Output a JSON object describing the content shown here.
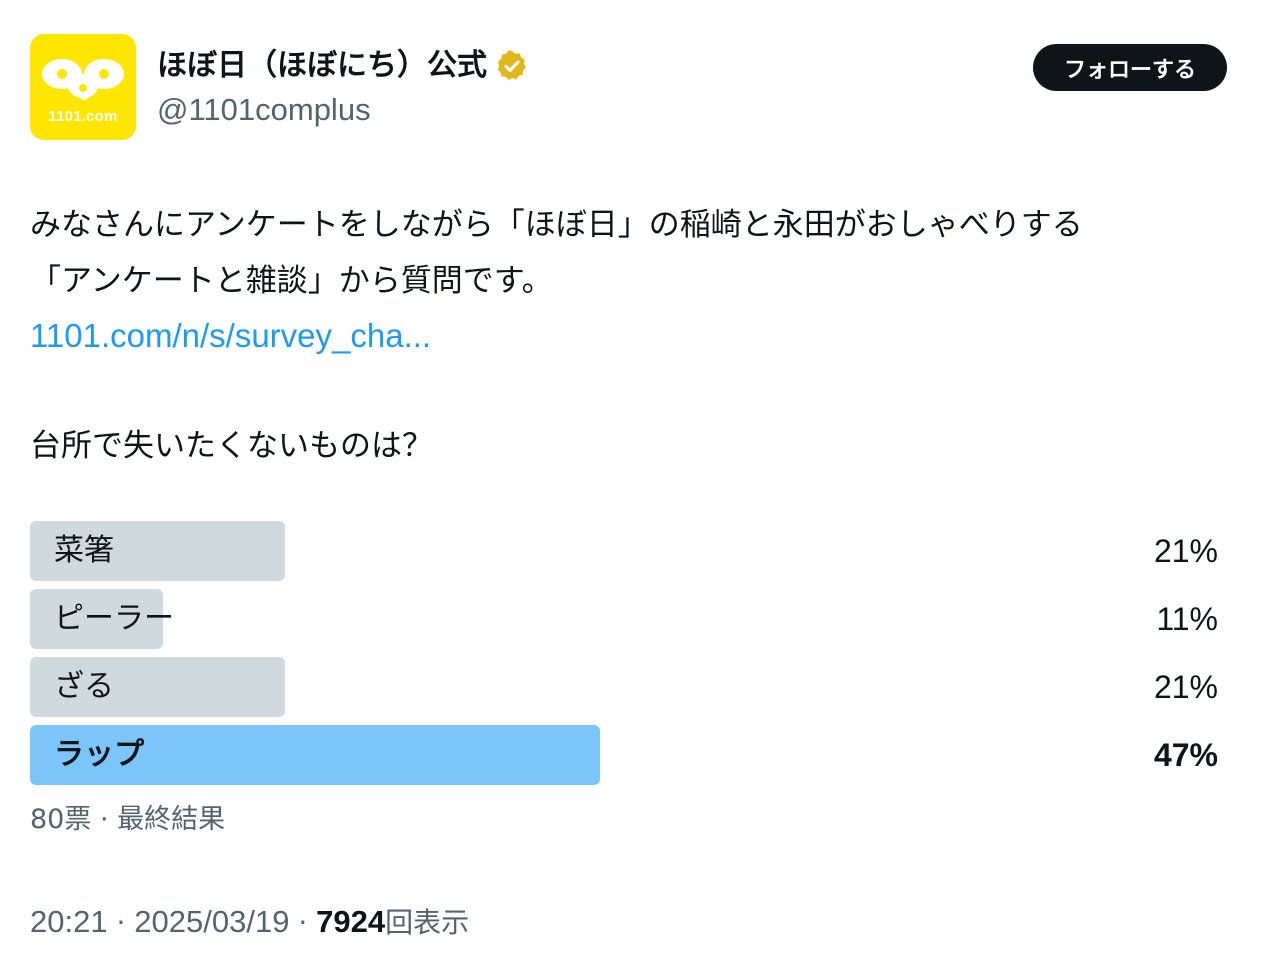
{
  "account": {
    "display_name": "ほぼ日（ほぼにち）公式",
    "handle": "@1101complus",
    "avatar_text": "1101.com",
    "avatar_color": "#ffe600",
    "verified_color": "#e2b719"
  },
  "follow_button": {
    "label": "フォローする"
  },
  "tweet": {
    "line1": "みなさんにアンケートをしながら「ほぼ日」の稲崎と永田がおしゃべりする",
    "line2": "「アンケートと雑談」から質問です。",
    "link": "1101.com/n/s/survey_cha...",
    "question": "台所で失いたくないものは？"
  },
  "poll": {
    "options": [
      {
        "label": "菜箸",
        "percent_text": "21%",
        "percent": 21,
        "winner": false
      },
      {
        "label": "ピーラー",
        "percent_text": "11%",
        "percent": 11,
        "winner": false
      },
      {
        "label": "ざる",
        "percent_text": "21%",
        "percent": 21,
        "winner": false
      },
      {
        "label": "ラップ",
        "percent_text": "47%",
        "percent": 47,
        "winner": true
      }
    ],
    "votes": "80票",
    "separator": " · ",
    "status": "最終結果"
  },
  "meta": {
    "time": "20:21",
    "date": "2025/03/19",
    "separator": " · ",
    "views_count": "7924",
    "views_label": "回表示"
  },
  "colors": {
    "bar_default": "#cfd9de",
    "bar_winner": "#7cc5f8",
    "link": "#1d9bf0",
    "secondary_text": "#536471"
  }
}
